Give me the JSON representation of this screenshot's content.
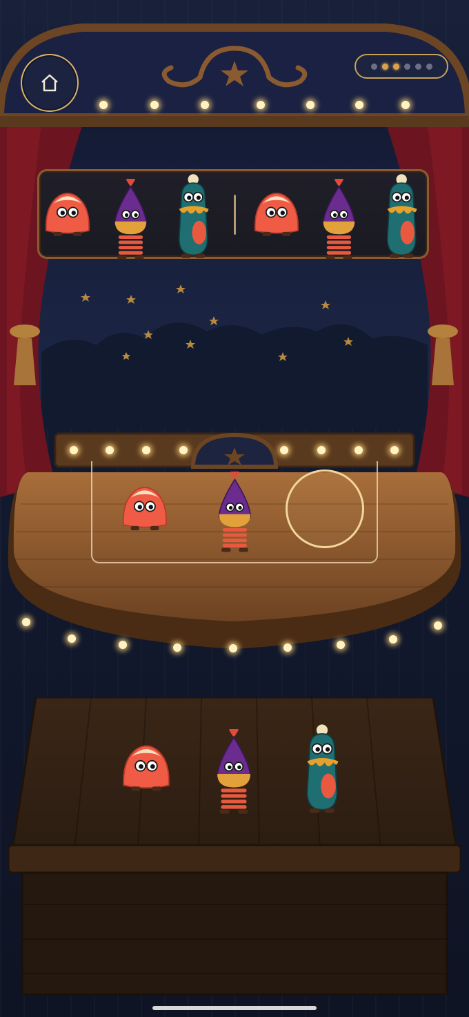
{
  "header": {
    "home_icon": "home-icon",
    "progress": {
      "total": 6,
      "completed": 2
    }
  },
  "target_sequence": [
    [
      "orange-blob",
      "purple-spring",
      "teal-clown"
    ],
    [
      "orange-blob",
      "purple-spring",
      "teal-clown"
    ]
  ],
  "stage_slots": [
    "orange-blob",
    "purple-spring",
    null
  ],
  "character_tray": [
    "orange-blob",
    "purple-spring",
    "teal-clown"
  ],
  "colors": {
    "curtain": "#7a1520",
    "wood": "#8a5a30",
    "gold": "#d9b46a",
    "orange_blob": "#ef5b45",
    "purple_spring": "#6a2c8f",
    "teal_clown": "#1f6f72"
  }
}
